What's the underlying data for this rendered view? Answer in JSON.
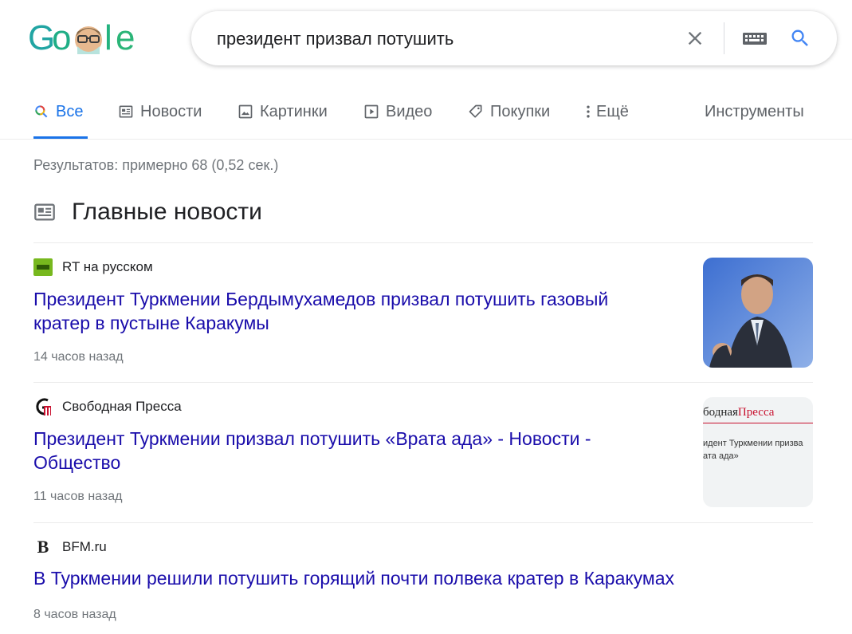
{
  "search": {
    "query": "президент призвал потушить"
  },
  "logo": {
    "letters": [
      "G",
      "o",
      "o",
      "g",
      "l",
      "e"
    ]
  },
  "tabs": [
    {
      "label": "Все",
      "icon": "search-icon",
      "active": true
    },
    {
      "label": "Новости",
      "icon": "news-icon",
      "active": false
    },
    {
      "label": "Картинки",
      "icon": "image-icon",
      "active": false
    },
    {
      "label": "Видео",
      "icon": "video-icon",
      "active": false
    },
    {
      "label": "Покупки",
      "icon": "tag-icon",
      "active": false
    },
    {
      "label": "Ещё",
      "icon": "more-vert-icon",
      "active": false
    }
  ],
  "tools_label": "Инструменты",
  "stats": "Результатов: примерно 68 (0,52 сек.)",
  "section_title": "Главные новости",
  "news": [
    {
      "source": "RT на русском",
      "favicon_text": "RT",
      "title_line1": "Президент Туркмении Бердымухамедов призвал потушить газовый",
      "title_line2": "кратер в пустыне Каракумы",
      "time": "14 часов назад"
    },
    {
      "source": "Свободная Пресса",
      "favicon_text": "СП",
      "title_line1": "Президент Туркмении призвал потушить «Врата ада» - Новости -",
      "title_line2": "Общество",
      "time": "11 часов назад",
      "thumb_brand_black": "бодная",
      "thumb_brand_red": "Пресса",
      "thumb_text1": "идент Туркмении призва",
      "thumb_text2": "ата ада»"
    },
    {
      "source": "BFM.ru",
      "favicon_text": "B",
      "title_line1": "В Туркмении решили потушить горящий почти полвека кратер в Каракумах",
      "time": "8 часов назад"
    }
  ],
  "colors": {
    "link": "#1a0dab",
    "accent": "#1a73e8",
    "muted": "#70757a",
    "rt_green": "#77b81e",
    "sp_red": "#c8102e"
  }
}
